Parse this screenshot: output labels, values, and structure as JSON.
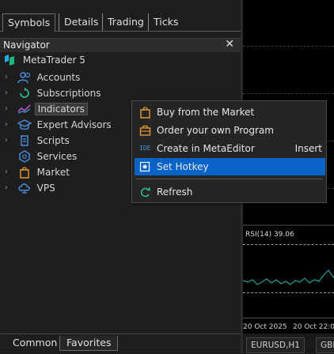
{
  "top_tabs": [
    "Symbols",
    "Details",
    "Trading",
    "Ticks"
  ],
  "navigator": {
    "title": "Navigator",
    "close_glyph": "✕",
    "root": "MetaTrader 5",
    "items": [
      {
        "label": "Accounts",
        "icon": "accounts-icon"
      },
      {
        "label": "Subscriptions",
        "icon": "subscriptions-icon"
      },
      {
        "label": "Indicators",
        "icon": "indicators-icon",
        "selected": true
      },
      {
        "label": "Expert Advisors",
        "icon": "expert-advisors-icon"
      },
      {
        "label": "Scripts",
        "icon": "scripts-icon"
      },
      {
        "label": "Services",
        "icon": "services-icon"
      },
      {
        "label": "Market",
        "icon": "market-icon"
      },
      {
        "label": "VPS",
        "icon": "vps-icon"
      }
    ]
  },
  "bottom_tabs": [
    "Common",
    "Favorites"
  ],
  "context_menu": {
    "items": [
      {
        "label": "Buy from the Market",
        "icon": "market-bag-icon",
        "shortcut": ""
      },
      {
        "label": "Order your own Program",
        "icon": "briefcase-icon",
        "shortcut": ""
      },
      {
        "label": "Create in MetaEditor",
        "icon": "ide-icon",
        "icon_text": "IDE",
        "shortcut": "Insert"
      },
      {
        "label": "Set Hotkey",
        "icon": "hotkey-icon",
        "shortcut": "",
        "highlighted": true
      },
      {
        "label": "Refresh",
        "icon": "refresh-icon",
        "shortcut": ""
      }
    ]
  },
  "chart": {
    "indicator_label": "RSI(14) 39.06",
    "x_labels": [
      "20 Oct 2025",
      "20 Oct 22:00"
    ],
    "symbol_tabs": [
      "EURUSD,H1",
      "GBI"
    ]
  },
  "colors": {
    "accent": "#0a64c8",
    "rsi_line": "#22a39a",
    "panel_bg": "#1e1e1e",
    "chart_bg": "#000000"
  }
}
